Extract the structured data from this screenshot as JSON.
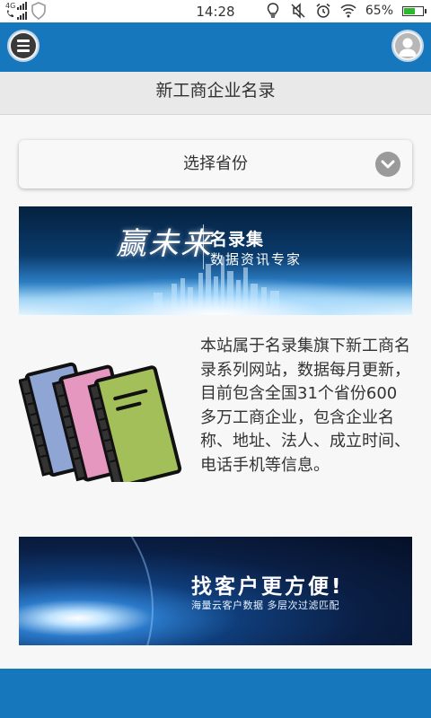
{
  "status_bar": {
    "network_top": "4G",
    "network_bottom": "",
    "time": "14:28",
    "battery": "65%",
    "battery_level": 0.65,
    "icons": [
      "signal-icon",
      "shield-icon",
      "bulb-icon",
      "mute-icon",
      "alarm-icon",
      "wifi-icon",
      "battery-icon"
    ]
  },
  "app_bar": {
    "menu_icon": "menu-icon",
    "user_icon": "user-avatar-icon",
    "color": "#1777bc"
  },
  "page": {
    "title": "新工商企业名录"
  },
  "province_select": {
    "placeholder": "选择省份",
    "icon": "chevron-down-icon"
  },
  "banner_top": {
    "brand": "赢未来",
    "title": "名录集",
    "subtitle": "数据资讯专家"
  },
  "intro": {
    "text": "本站属于名录集旗下新工商名录系列网站，数据每月更新，目前包含全国31个省份600多万工商企业，包含企业名称、地址、法人、成立时间、电话手机等信息。",
    "image": "books-icon"
  },
  "banner_bottom": {
    "title": "找客户更方便!",
    "subtitle": "海量云客户数据   多层次过滤匹配"
  }
}
